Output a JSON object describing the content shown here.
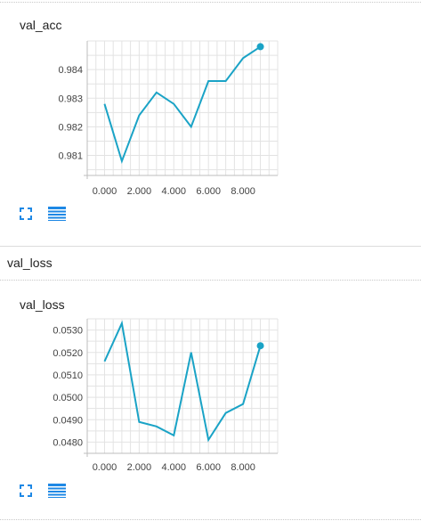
{
  "accent_color": "#1aa3c6",
  "icon_color": "#1e88e5",
  "cards": [
    {
      "title": "val_acc",
      "expand_icon": "fullscreen-icon",
      "log_icon": "log-scale-icon"
    },
    {
      "title": "val_loss",
      "expand_icon": "fullscreen-icon",
      "log_icon": "log-scale-icon"
    }
  ],
  "section": {
    "title": "val_loss"
  },
  "chart_data": [
    {
      "type": "line",
      "title": "val_acc",
      "x": [
        0,
        1,
        2,
        3,
        4,
        5,
        6,
        7,
        8,
        9
      ],
      "series": [
        {
          "values": [
            0.9828,
            0.9808,
            0.9824,
            0.9832,
            0.9828,
            0.982,
            0.9836,
            0.9836,
            0.9844,
            0.9848
          ]
        }
      ],
      "xlim": [
        -1,
        10
      ],
      "ylim": [
        0.9803,
        0.985
      ],
      "xticks": [
        0,
        2,
        4,
        6,
        8
      ],
      "xtick_labels": [
        "0.000",
        "2.000",
        "4.000",
        "6.000",
        "8.000"
      ],
      "yticks": [
        0.981,
        0.982,
        0.983,
        0.984
      ],
      "ytick_labels": [
        "0.981",
        "0.982",
        "0.983",
        "0.984"
      ],
      "grid": true
    },
    {
      "type": "line",
      "title": "val_loss",
      "x": [
        0,
        1,
        2,
        3,
        4,
        5,
        6,
        7,
        8,
        9
      ],
      "series": [
        {
          "values": [
            0.0516,
            0.0533,
            0.0489,
            0.0487,
            0.0483,
            0.052,
            0.0481,
            0.0493,
            0.0497,
            0.0523
          ]
        }
      ],
      "xlim": [
        -1,
        10
      ],
      "ylim": [
        0.0475,
        0.0535
      ],
      "xticks": [
        0,
        2,
        4,
        6,
        8
      ],
      "xtick_labels": [
        "0.000",
        "2.000",
        "4.000",
        "6.000",
        "8.000"
      ],
      "yticks": [
        0.048,
        0.049,
        0.05,
        0.051,
        0.052,
        0.053
      ],
      "ytick_labels": [
        "0.0480",
        "0.0490",
        "0.0500",
        "0.0510",
        "0.0520",
        "0.0530"
      ],
      "grid": true
    }
  ]
}
